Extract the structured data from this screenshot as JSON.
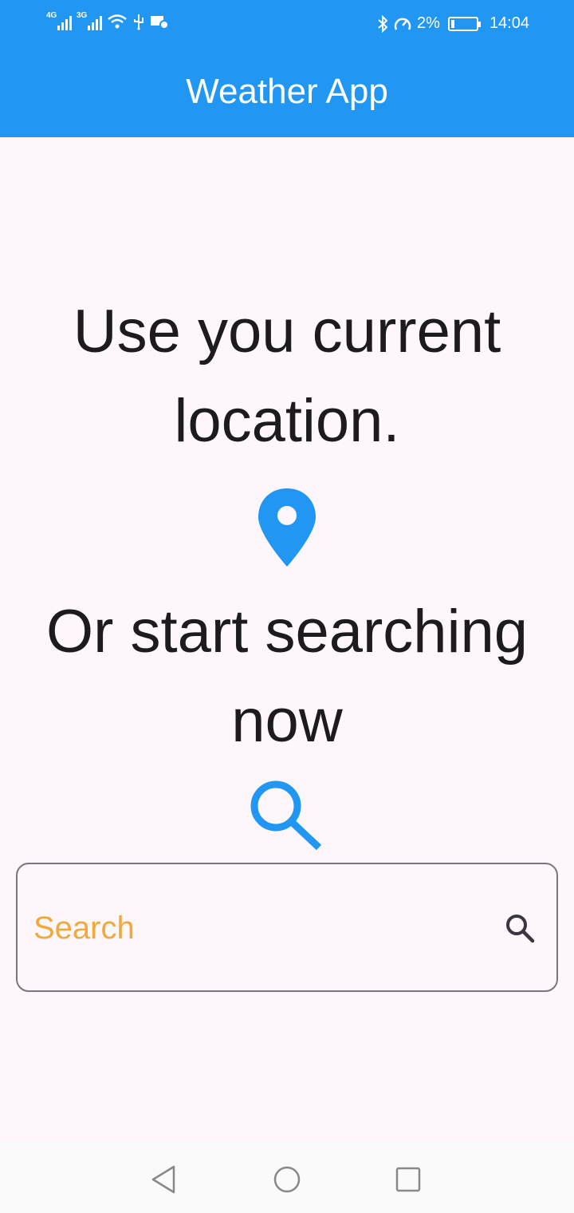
{
  "status_bar": {
    "network_1": "4G",
    "network_2": "3G",
    "battery_percent": "2%",
    "time": "14:04"
  },
  "app_bar": {
    "title": "Weather App"
  },
  "main": {
    "location_prompt": "Use you current location.",
    "search_prompt": "Or start searching now"
  },
  "search": {
    "placeholder": "Search",
    "value": ""
  },
  "icons": {
    "location": "location-pin-icon",
    "search_large": "search-icon",
    "search_button": "search-icon"
  },
  "colors": {
    "primary": "#2196f3",
    "background": "#fdf7fc",
    "placeholder": "#f2a93b",
    "text": "#1d1b20"
  }
}
